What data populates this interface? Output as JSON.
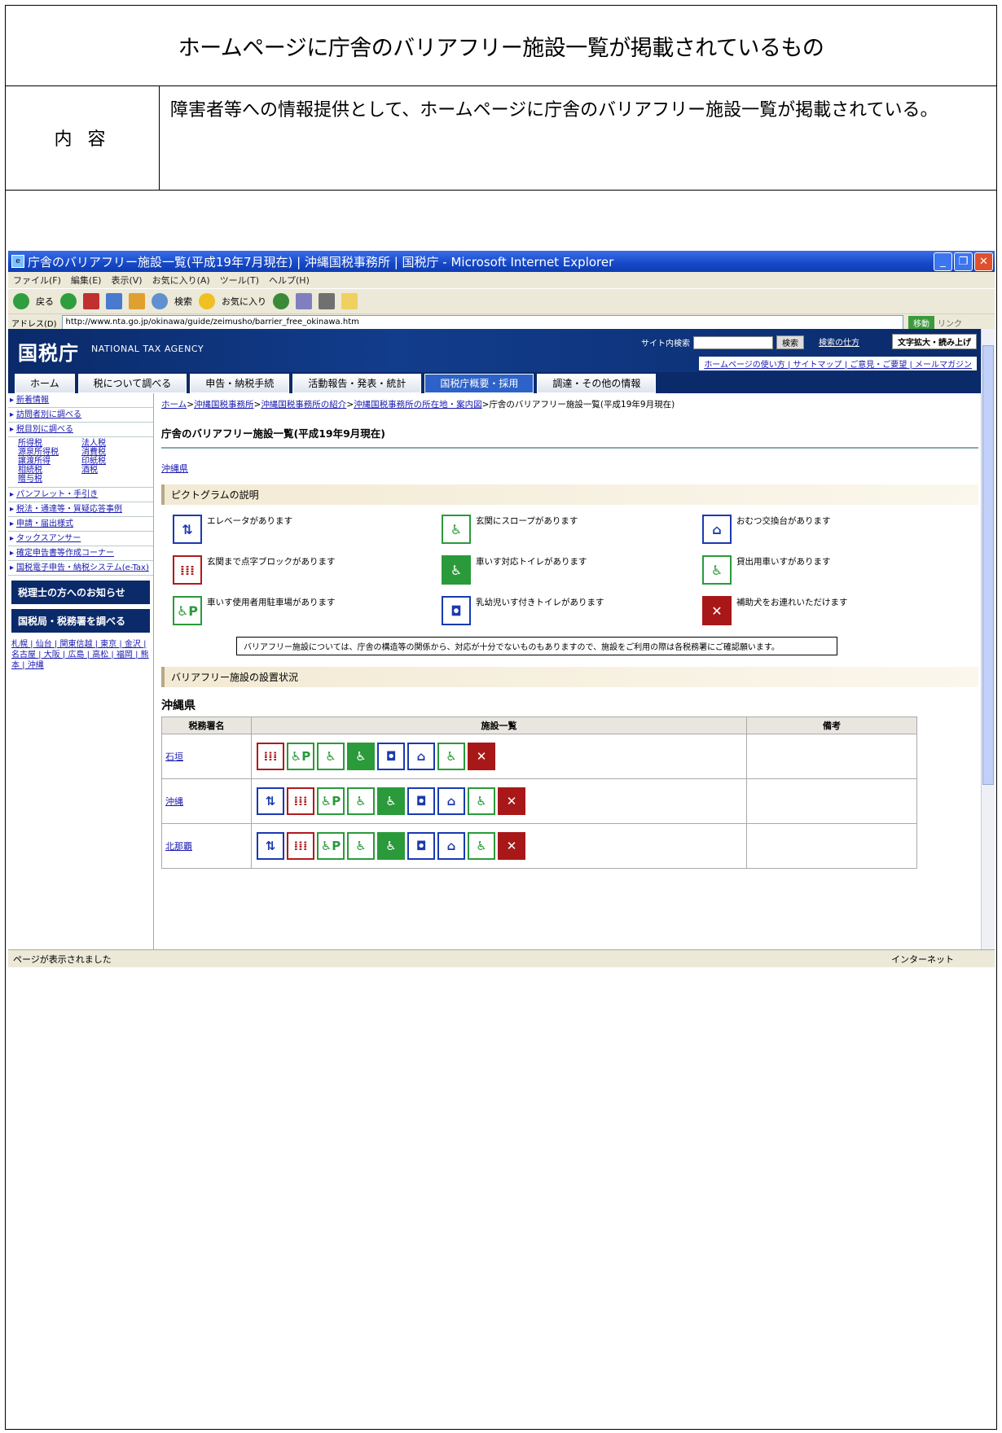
{
  "doc": {
    "title": "ホームページに庁舎のバリアフリー施設一覧が掲載されているもの",
    "label": "内 容",
    "content": "障害者等への情報提供として、ホームページに庁舎のバリアフリー施設一覧が掲載されている。"
  },
  "browser": {
    "title": "庁舎のバリアフリー施設一覧(平成19年7月現在) | 沖縄国税事務所 | 国税庁 - Microsoft Internet Explorer",
    "menu": [
      "ファイル(F)",
      "編集(E)",
      "表示(V)",
      "お気に入り(A)",
      "ツール(T)",
      "ヘルプ(H)"
    ],
    "toolbar": {
      "back": "戻る",
      "search": "検索",
      "favorites": "お気に入り"
    },
    "address_label": "アドレス(D)",
    "url": "http://www.nta.go.jp/okinawa/guide/zeimusho/barrier_free_okinawa.htm",
    "go": "移動",
    "links": "リンク",
    "status": "ページが表示されました",
    "zone": "インターネット"
  },
  "site": {
    "logo": "国税庁",
    "logo_en": "NATIONAL TAX AGENCY",
    "search_label": "サイト内検索",
    "search_button": "検索",
    "howto_search": "検索の仕方",
    "zoom": "文字拡大・読み上げ",
    "sublinks": "ホームページの使い方 | サイトマップ | ご意見・ご要望 | メールマガジン",
    "nav": [
      "ホーム",
      "税について調べる",
      "申告・納税手続",
      "活動報告・発表・統計",
      "国税庁概要・採用",
      "調達・その他の情報"
    ]
  },
  "sidebar": {
    "items": [
      "新着情報",
      "訪問者別に調べる",
      "税目別に調べる"
    ],
    "taxes": [
      "所得税",
      "法人税",
      "源泉所得税",
      "消費税",
      "譲渡所得",
      "印紙税",
      "相続税",
      "酒税",
      "贈与税",
      ""
    ],
    "items2": [
      "パンフレット・手引き",
      "税法・通達等・質疑応答事例",
      "申請・届出様式",
      "タックスアンサー",
      "確定申告書等作成コーナー",
      "国税電子申告・納税システム(e-Tax)"
    ],
    "btn1": "税理士の方へのお知らせ",
    "btn2": "国税局・税務署を調べる",
    "regions": "札幌 | 仙台 | 関東信越 | 東京 | 金沢 | 名古屋 | 大阪 | 広島 | 高松 | 福岡 | 熊本 | 沖縄"
  },
  "main": {
    "breadcrumb": [
      "ホーム",
      "沖縄国税事務所",
      "沖縄国税事務所の紹介",
      "沖縄国税事務所の所在地・案内図"
    ],
    "breadcrumb_current": "庁舎のバリアフリー施設一覧(平成19年9月現在)",
    "heading": "庁舎のバリアフリー施設一覧(平成19年9月現在)",
    "pref_link": "沖縄県",
    "picto_heading": "ピクトグラムの説明",
    "pictograms": [
      {
        "icon": "elevator-icon",
        "label": "エレベータがあります",
        "style": "blue",
        "glyph": "⇅"
      },
      {
        "icon": "slope-icon",
        "label": "玄関にスロープがあります",
        "style": "green",
        "glyph": "♿"
      },
      {
        "icon": "diaper-table-icon",
        "label": "おむつ交換台があります",
        "style": "blue",
        "glyph": "⌂"
      },
      {
        "icon": "tactile-block-icon",
        "label": "玄関まで点字ブロックがあります",
        "style": "red",
        "glyph": "⁞⁞⁞"
      },
      {
        "icon": "wheelchair-toilet-icon",
        "label": "車いす対応トイレがあります",
        "style": "greenfill",
        "glyph": "♿"
      },
      {
        "icon": "wheelchair-rental-icon",
        "label": "貸出用車いすがあります",
        "style": "green",
        "glyph": "♿"
      },
      {
        "icon": "wheelchair-parking-icon",
        "label": "車いす使用者用駐車場があります",
        "style": "green",
        "glyph": "♿P"
      },
      {
        "icon": "baby-seat-toilet-icon",
        "label": "乳幼児いす付きトイレがあります",
        "style": "blue",
        "glyph": "◘"
      },
      {
        "icon": "assistance-dog-icon",
        "label": "補助犬をお連れいただけます",
        "style": "redfill",
        "glyph": "✕"
      }
    ],
    "notice": "バリアフリー施設については、庁舎の構造等の関係から、対応が十分でないものもありますので、施設をご利用の際は各税務署にご確認願います。",
    "status_heading": "バリアフリー施設の設置状況",
    "pref_heading": "沖縄県",
    "table_headers": [
      "税務署名",
      "施設一覧",
      "備考"
    ],
    "offices": [
      {
        "name": "石垣",
        "icons": [
          "tactile-block-icon",
          "wheelchair-parking-icon",
          "slope-icon",
          "wheelchair-toilet-icon",
          "baby-seat-toilet-icon",
          "diaper-table-icon",
          "wheelchair-rental-icon",
          "assistance-dog-icon"
        ]
      },
      {
        "name": "沖縄",
        "icons": [
          "elevator-icon",
          "tactile-block-icon",
          "wheelchair-parking-icon",
          "slope-icon",
          "wheelchair-toilet-icon",
          "baby-seat-toilet-icon",
          "diaper-table-icon",
          "wheelchair-rental-icon",
          "assistance-dog-icon"
        ]
      },
      {
        "name": "北那覇",
        "icons": [
          "elevator-icon",
          "tactile-block-icon",
          "wheelchair-parking-icon",
          "slope-icon",
          "wheelchair-toilet-icon",
          "baby-seat-toilet-icon",
          "diaper-table-icon",
          "wheelchair-rental-icon",
          "assistance-dog-icon"
        ]
      }
    ]
  }
}
